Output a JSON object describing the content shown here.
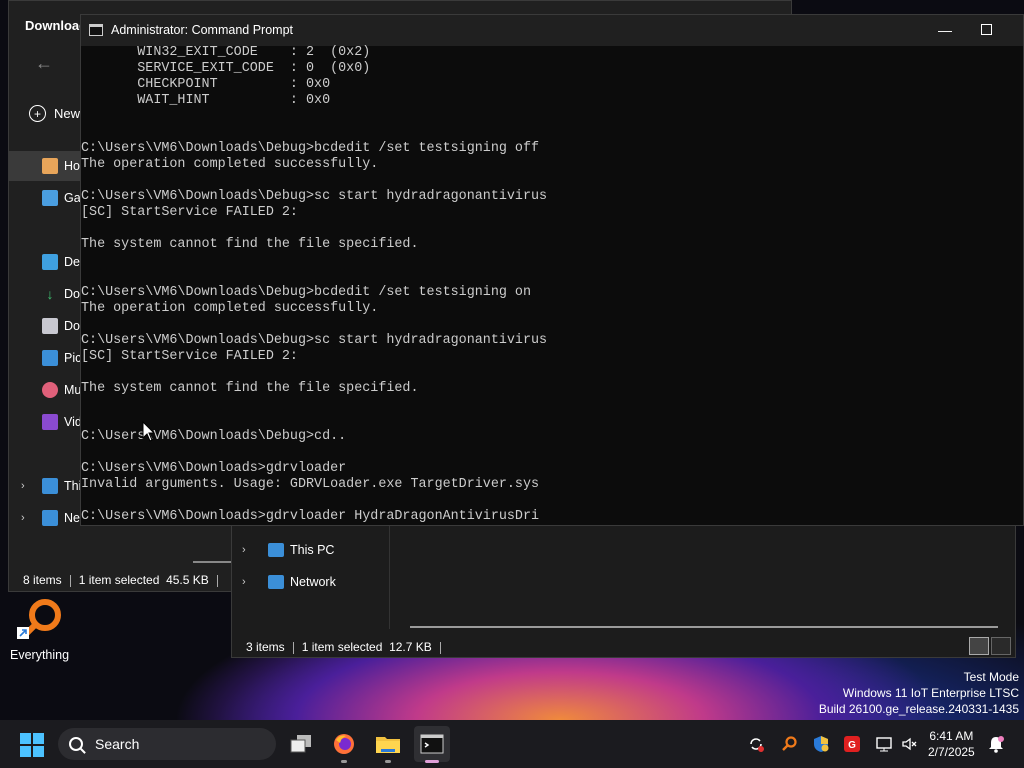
{
  "explorer_back": {
    "title": "Download",
    "new_label": "New",
    "nav": [
      "Ho",
      "Gal",
      "Des",
      "Dov",
      "Doc",
      "Pic",
      "Mu",
      "Vid",
      "Thi",
      "Net"
    ],
    "status": {
      "items": "8 items",
      "selected": "1 item selected",
      "size": "45.5 KB"
    }
  },
  "explorer_front": {
    "nav": [
      {
        "label": "This PC"
      },
      {
        "label": "Network"
      }
    ],
    "status": {
      "items": "3 items",
      "selected": "1 item selected",
      "size": "12.7 KB"
    }
  },
  "cmd": {
    "title": "Administrator: Command Prompt",
    "lines": [
      "       WIN32_EXIT_CODE    : 2  (0x2)",
      "       SERVICE_EXIT_CODE  : 0  (0x0)",
      "       CHECKPOINT         : 0x0",
      "       WAIT_HINT          : 0x0",
      "",
      "",
      "C:\\Users\\VM6\\Downloads\\Debug>bcdedit /set testsigning off",
      "The operation completed successfully.",
      "",
      "C:\\Users\\VM6\\Downloads\\Debug>sc start hydradragonantivirus",
      "[SC] StartService FAILED 2:",
      "",
      "The system cannot find the file specified.",
      "",
      "",
      "C:\\Users\\VM6\\Downloads\\Debug>bcdedit /set testsigning on",
      "The operation completed successfully.",
      "",
      "C:\\Users\\VM6\\Downloads\\Debug>sc start hydradragonantivirus",
      "[SC] StartService FAILED 2:",
      "",
      "The system cannot find the file specified.",
      "",
      "",
      "C:\\Users\\VM6\\Downloads\\Debug>cd..",
      "",
      "C:\\Users\\VM6\\Downloads>gdrvloader",
      "Invalid arguments. Usage: GDRVLoader.exe TargetDriver.sys",
      "",
      "C:\\Users\\VM6\\Downloads>gdrvloader HydraDragonAntivirusDri"
    ]
  },
  "desktop": {
    "everything_label": "Everything",
    "watermark": [
      "Test Mode",
      "Windows 11 IoT Enterprise LTSC",
      "Build 26100.ge_release.240331-1435"
    ]
  },
  "taskbar": {
    "search_placeholder": "Search",
    "time": "6:41 AM",
    "date": "2/7/2025"
  },
  "colors": {
    "accent": "#4cc2ff",
    "terminal_text": "#cccccc",
    "terminal_bg": "#0c0c0c"
  }
}
